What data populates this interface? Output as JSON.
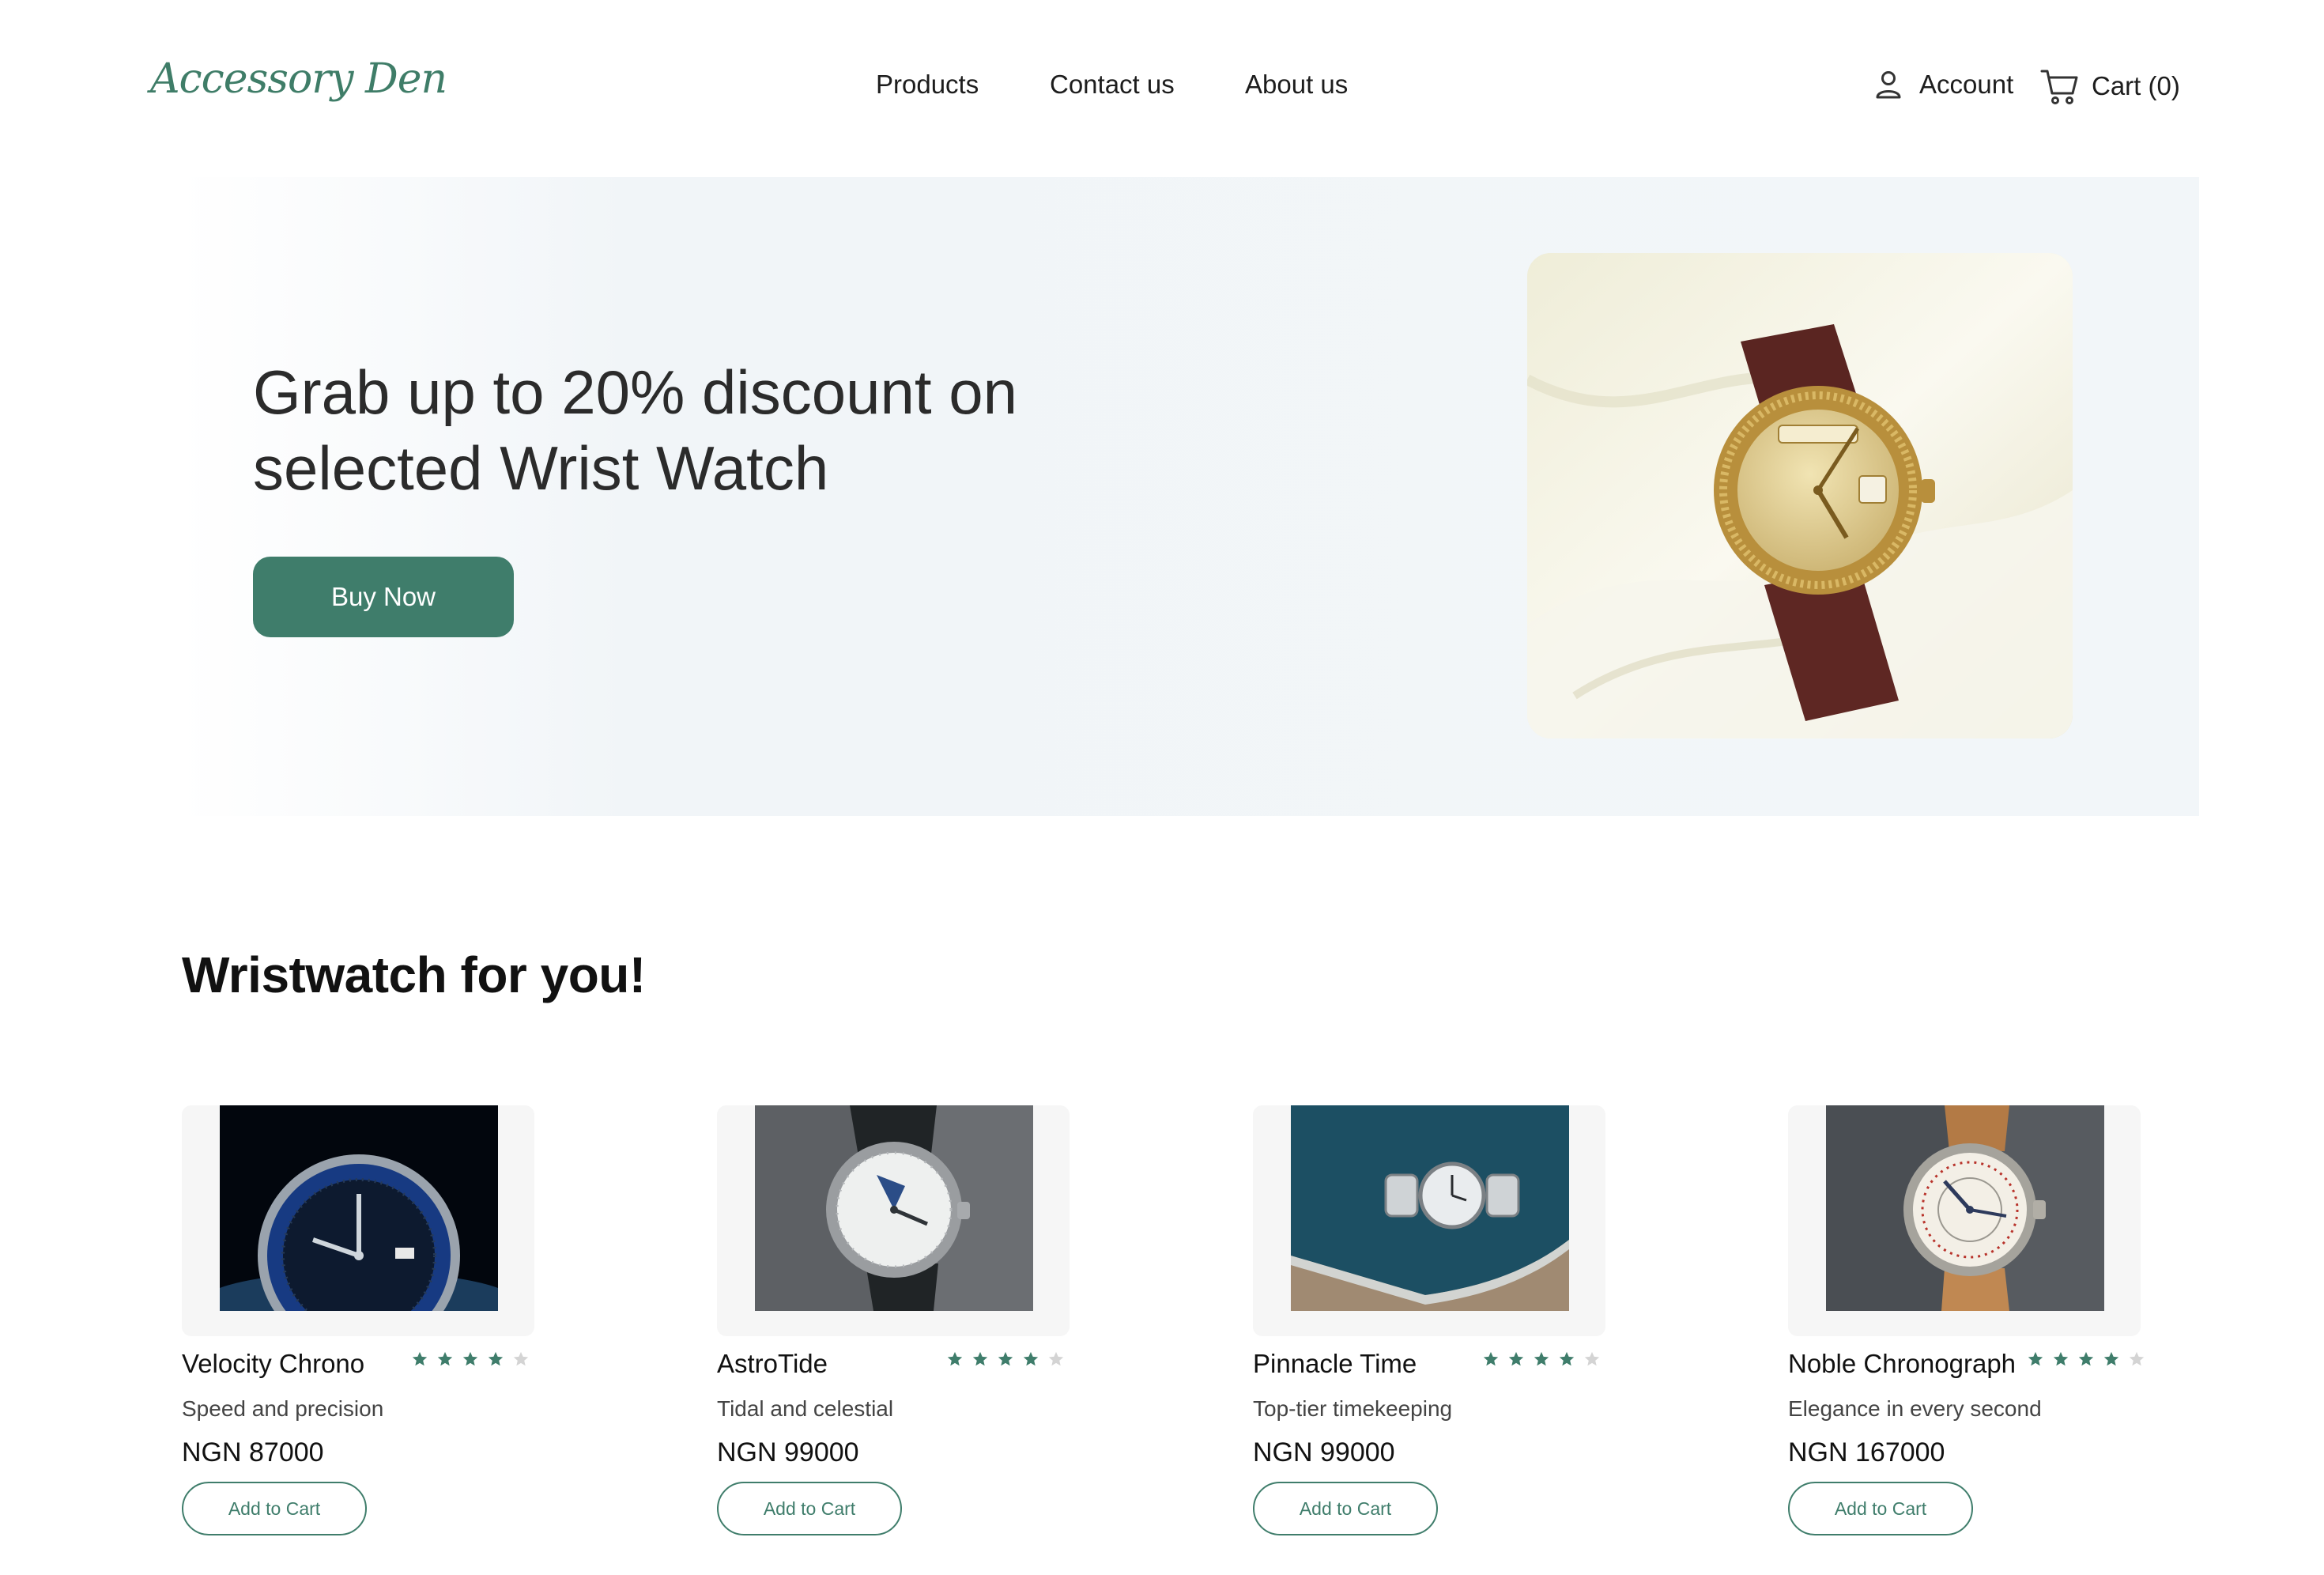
{
  "header": {
    "logo": "Accessory Den",
    "nav": [
      "Products",
      "Contact us",
      "About us"
    ],
    "account_label": "Account",
    "cart_label": "Cart (0)"
  },
  "hero": {
    "heading": "Grab up to 20% discount on selected Wrist Watch",
    "button_label": "Buy Now"
  },
  "section": {
    "title": "Wristwatch for you!"
  },
  "products": [
    {
      "name": "Velocity Chrono",
      "description": "Speed and precision",
      "price": "NGN 87000",
      "rating": 4,
      "button": "Add to Cart"
    },
    {
      "name": "AstroTide",
      "description": "Tidal and celestial",
      "price": "NGN 99000",
      "rating": 4,
      "button": "Add to Cart"
    },
    {
      "name": "Pinnacle Time",
      "description": "Top-tier timekeeping",
      "price": "NGN 99000",
      "rating": 4,
      "button": "Add to Cart"
    },
    {
      "name": "Noble Chronograph",
      "description": "Elegance in every second",
      "price": "NGN 167000",
      "rating": 4,
      "button": "Add to Cart"
    }
  ],
  "colors": {
    "brand": "#3f7d6b",
    "hero_bg": "#f2f6f9",
    "star_filled": "#3f7d6b",
    "star_empty": "#d4d4d4"
  },
  "icons": {
    "account": "user-icon",
    "cart": "shopping-cart-icon",
    "rating": "star-icon"
  }
}
